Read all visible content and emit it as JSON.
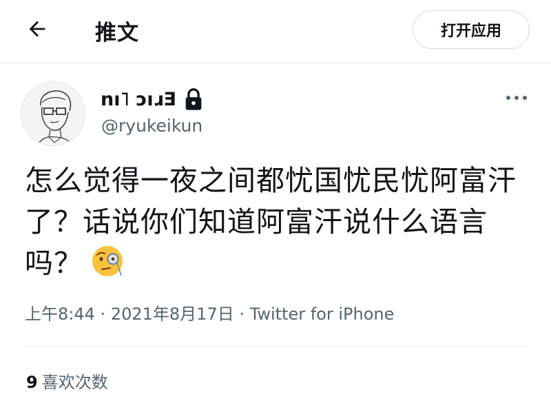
{
  "header": {
    "title": "推文",
    "open_app_label": "打开应用",
    "back_icon": "arrow-left-icon"
  },
  "author": {
    "display_name": "nı˥ ɔıɹƎ",
    "handle": "@ryukeikun",
    "protected_icon": "lock-icon",
    "avatar": "sketch-portrait"
  },
  "tweet": {
    "text": "怎么觉得一夜之间都忧国忧民忧阿富汗了？话说你们知道阿富汗说什么语言吗？",
    "emoji": "face-with-monocle-icon",
    "time": "上午8:44",
    "date": "2021年8月17日",
    "separator": "·",
    "source": "Twitter for iPhone"
  },
  "stats": {
    "likes_count": "9",
    "likes_label": "喜欢次数"
  },
  "colors": {
    "text_primary": "#0f1419",
    "text_secondary": "#536471",
    "border": "#cfd9de"
  }
}
